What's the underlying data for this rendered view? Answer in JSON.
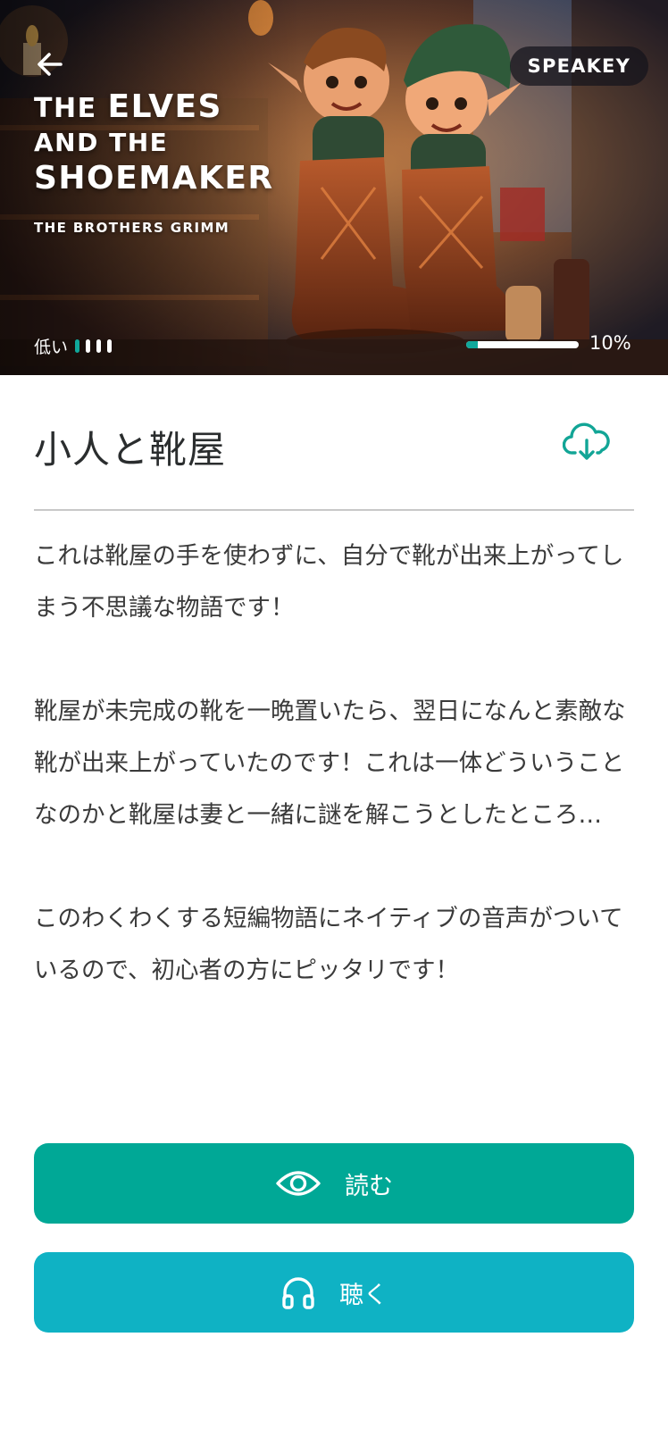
{
  "hero": {
    "brand": "SPEAKEY",
    "cover_title_line1_prefix": "THE",
    "cover_title_line1_main": "ELVES",
    "cover_title_line2": "AND THE",
    "cover_title_line3": "SHOEMAKER",
    "cover_author": "THE BROTHERS GRIMM",
    "level_label": "低い",
    "level_value": 1,
    "level_max": 4,
    "progress_fraction": 0.1,
    "progress_label": "10%"
  },
  "book": {
    "title": "小人と靴屋",
    "paragraphs": [
      "これは靴屋の手を使わずに、自分で靴が出来上がってしまう不思議な物語です！",
      "靴屋が未完成の靴を一晩置いたら、翌日になんと素敵な靴が出来上がっていたのです！これは一体どういうことなのかと靴屋は妻と一緒に謎を解こうとしたところ…",
      "このわくわくする短編物語にネイティブの音声がついているので、初心者の方にピッタリです！"
    ]
  },
  "actions": {
    "read_label": "読む",
    "listen_label": "聴く"
  },
  "colors": {
    "accent_green": "#00a896",
    "accent_cyan": "#0fb2c4",
    "progress_fill": "#10a89b"
  },
  "icons": {
    "back": "arrow-left-icon",
    "download": "cloud-download-icon",
    "read": "eye-icon",
    "listen": "headphones-icon"
  }
}
